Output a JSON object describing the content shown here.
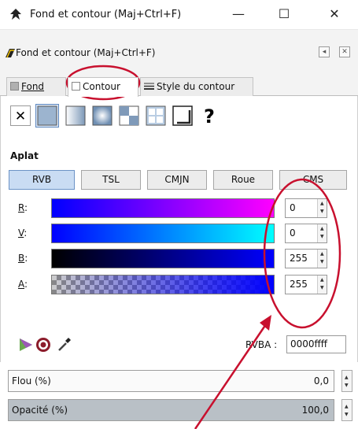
{
  "window": {
    "title": "Fond et contour (Maj+Ctrl+F)",
    "minimize_glyph": "—",
    "maximize_glyph": "☐",
    "close_glyph": "✕"
  },
  "panel": {
    "title": "Fond et contour (Maj+Ctrl+F)",
    "btn_left_glyph": "◂",
    "btn_right_glyph": "✕"
  },
  "tabs": [
    {
      "label": "Fond",
      "icon": "fill-square-icon",
      "mnemonic": "F"
    },
    {
      "label": "Contour",
      "icon": "stroke-square-icon"
    },
    {
      "label": "Style du contour",
      "icon": "stroke-style-icon"
    }
  ],
  "paint_types": [
    {
      "name": "no-paint",
      "glyph": "✕"
    },
    {
      "name": "flat-color"
    },
    {
      "name": "linear-gradient"
    },
    {
      "name": "radial-gradient"
    },
    {
      "name": "pattern"
    },
    {
      "name": "swatch"
    },
    {
      "name": "mesh"
    },
    {
      "name": "unset",
      "glyph": "?"
    }
  ],
  "section_label": "Aplat",
  "color_modes": [
    {
      "label": "RVB",
      "active": true
    },
    {
      "label": "TSL",
      "active": false
    },
    {
      "label": "CMJN",
      "active": false
    },
    {
      "label": "Roue",
      "active": false
    },
    {
      "label": "CMS",
      "active": false
    }
  ],
  "channels": [
    {
      "mnemonic": "R",
      "suffix": ":",
      "value": "0",
      "gradient_from": "#0000ff",
      "gradient_to": "#ff00ff"
    },
    {
      "mnemonic": "V",
      "suffix": ":",
      "value": "0",
      "gradient_from": "#0000ff",
      "gradient_to": "#00ffff"
    },
    {
      "mnemonic": "B",
      "suffix": ":",
      "value": "255",
      "gradient_from": "#000000",
      "gradient_to": "#0000ff"
    },
    {
      "mnemonic": "A",
      "suffix": ":",
      "value": "255",
      "gradient_from": "#0000ff00",
      "gradient_to": "#0000ff"
    }
  ],
  "rgba": {
    "label": "RVBA :",
    "value": "0000ffff"
  },
  "blur": {
    "label": "Flou (%)",
    "value": "0,0"
  },
  "opacity": {
    "label": "Opacité (%)",
    "value": "100,0"
  },
  "accent_red": "#c8102e",
  "active_mode_color": "#c9dcf3"
}
